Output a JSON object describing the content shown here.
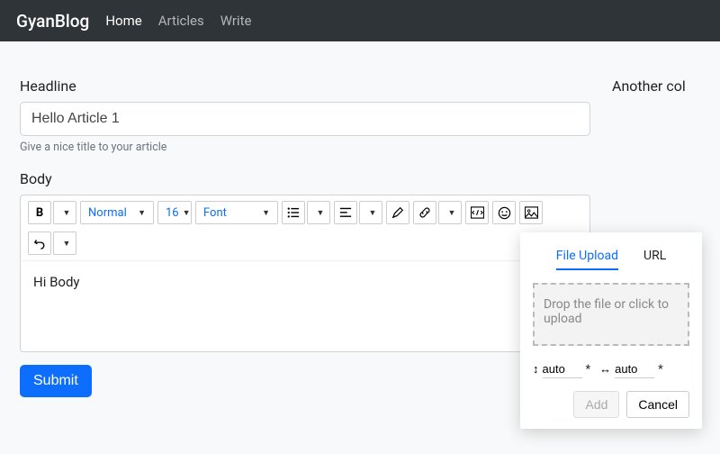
{
  "nav": {
    "brand": "GyanBlog",
    "items": [
      "Home",
      "Articles",
      "Write"
    ],
    "active": 0
  },
  "sidebar": {
    "title": "Another col"
  },
  "form": {
    "headline_label": "Headline",
    "headline_value": "Hello Article 1",
    "headline_help": "Give a nice title to your article",
    "body_label": "Body",
    "body_content": "Hi Body",
    "submit": "Submit"
  },
  "toolbar": {
    "style": "Normal",
    "size": "16",
    "font": "Font"
  },
  "upload": {
    "tab_file": "File Upload",
    "tab_url": "URL",
    "drop": "Drop the file or click to upload",
    "w": "auto",
    "h": "auto",
    "add": "Add",
    "cancel": "Cancel"
  }
}
